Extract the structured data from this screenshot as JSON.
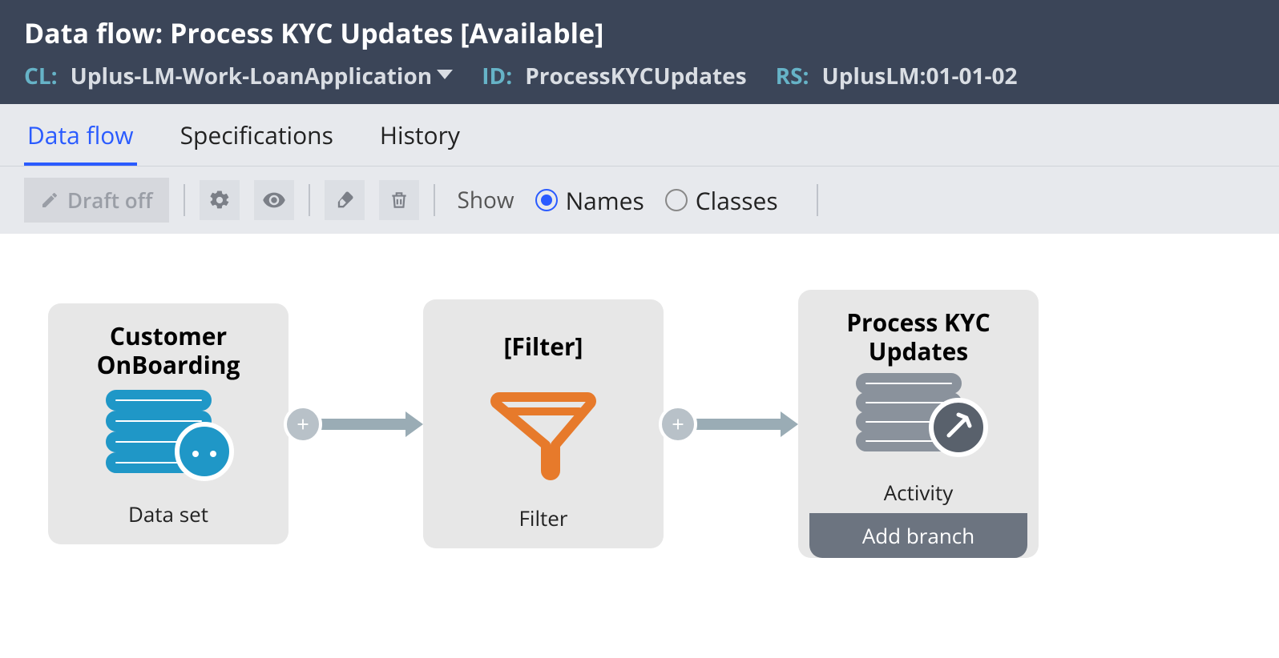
{
  "header": {
    "title": "Data flow: Process KYC Updates [Available]",
    "cl_key": "CL:",
    "cl_val": "Uplus-LM-Work-LoanApplication",
    "id_key": "ID:",
    "id_val": "ProcessKYCUpdates",
    "rs_key": "RS:",
    "rs_val": "UplusLM:01-01-02"
  },
  "tabs": {
    "data_flow": "Data flow",
    "specifications": "Specifications",
    "history": "History"
  },
  "toolbar": {
    "draft_label": "Draft off",
    "show_label": "Show",
    "radio_names": "Names",
    "radio_classes": "Classes"
  },
  "nodes": {
    "n1": {
      "title": "Customer OnBoarding",
      "subtitle": "Data set"
    },
    "n2": {
      "title": "[Filter]",
      "subtitle": "Filter"
    },
    "n3": {
      "title": "Process KYC Updates",
      "subtitle": "Activity",
      "add_branch": "Add branch"
    }
  }
}
